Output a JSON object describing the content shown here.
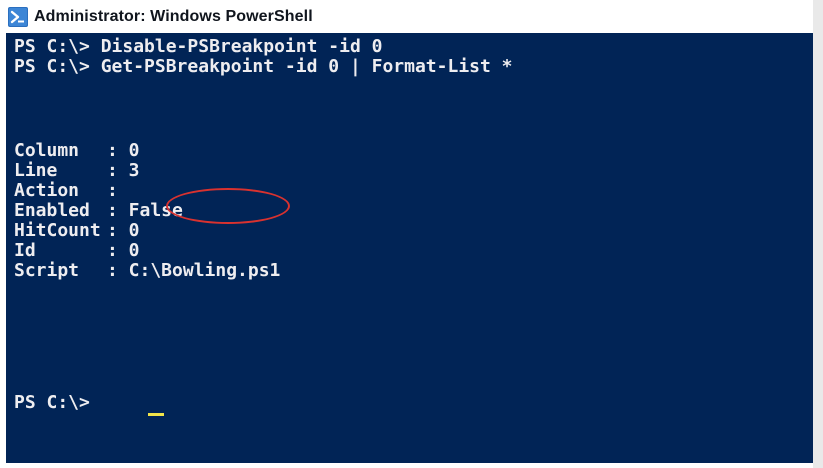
{
  "window": {
    "title": "Administrator: Windows PowerShell",
    "icon": "powershell-icon",
    "console_background": "#012456",
    "console_text_color": "#eeedf0",
    "highlight_color": "#d9322f"
  },
  "console": {
    "commands": [
      "PS C:\\> Disable-PSBreakpoint -id 0",
      "PS C:\\> Get-PSBreakpoint -id 0 | Format-List *"
    ],
    "properties": [
      {
        "key": "Column",
        "value": ": 0"
      },
      {
        "key": "Line",
        "value": ": 3"
      },
      {
        "key": "Action",
        "value": ":"
      },
      {
        "key": "Enabled",
        "value": ": False"
      },
      {
        "key": "HitCount",
        "value": ": 0"
      },
      {
        "key": "Id",
        "value": ": 0"
      },
      {
        "key": "Script",
        "value": ": C:\\Bowling.ps1"
      }
    ],
    "prompt": "PS C:\\>",
    "highlighted_value": "False"
  }
}
